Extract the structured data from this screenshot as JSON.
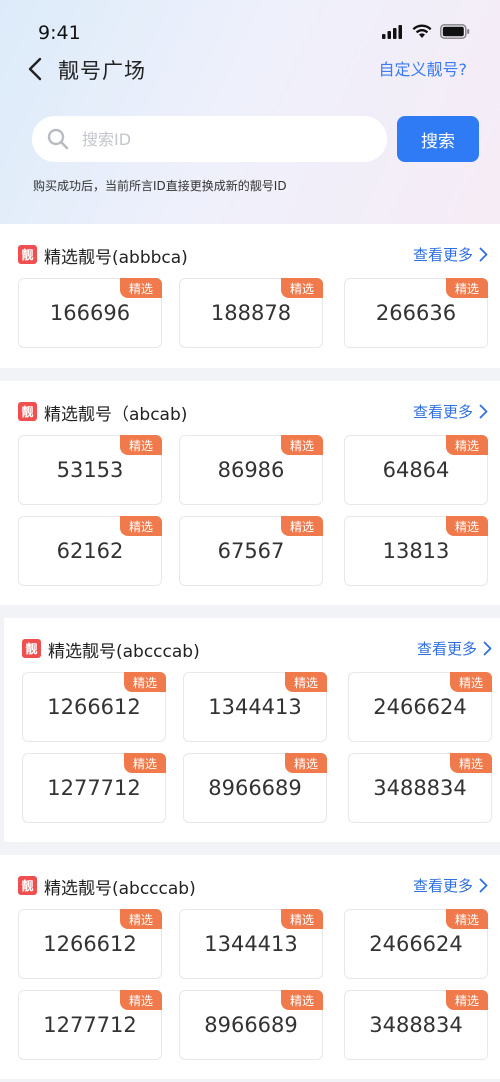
{
  "status": {
    "time": "9:41"
  },
  "nav": {
    "title": "靓号广场",
    "right_link": "自定义靓号?"
  },
  "search": {
    "placeholder": "搜索ID",
    "button": "搜索",
    "tip": "购买成功后，当前所言ID直接更换成新的靓号ID"
  },
  "colors": {
    "primary": "#2f7bf6",
    "tag": "#f07a4c",
    "badge": "#ef4f4f",
    "link": "#2f6fe0"
  },
  "sections": [
    {
      "badge": "靓",
      "title": "精选靓号(abbbca)",
      "more": "查看更多",
      "numbers": [
        "166696",
        "188878",
        "266636"
      ],
      "tag": "精选"
    },
    {
      "badge": "靓",
      "title": "精选靓号（abcab)",
      "more": "查看更多",
      "numbers": [
        "53153",
        "86986",
        "64864",
        "62162",
        "67567",
        "13813"
      ],
      "tag": "精选"
    },
    {
      "badge": "靓",
      "title": "精选靓号(abcccab)",
      "more": "查看更多",
      "numbers": [
        "1266612",
        "1344413",
        "2466624",
        "1277712",
        "8966689",
        "3488834"
      ],
      "tag": "精选"
    },
    {
      "badge": "靓",
      "title": "精选靓号(abcccab)",
      "more": "查看更多",
      "numbers": [
        "1266612",
        "1344413",
        "2466624",
        "1277712",
        "8966689",
        "3488834"
      ],
      "tag": "精选"
    }
  ]
}
